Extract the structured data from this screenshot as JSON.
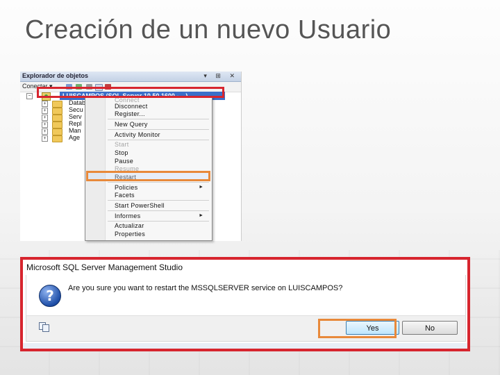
{
  "slide": {
    "title": "Creación de un nuevo Usuario"
  },
  "object_explorer": {
    "panel_title": "Explorador de objetos",
    "title_buttons": "▾ ⊞ ✕",
    "toolbar": {
      "connect_label": "Conectar ▾"
    },
    "root_node": "LUISCAMPOS (SQL Server 10.50.1600 - ...)",
    "tree_items": [
      "Datab",
      "Secu",
      "Serv",
      "Repl",
      "Man",
      "Age"
    ]
  },
  "context_menu": {
    "items": [
      {
        "label": "Connect",
        "disabled": true
      },
      {
        "label": "Disconnect",
        "disabled": false
      },
      {
        "label": "Register...",
        "disabled": false
      },
      {
        "label": "New Query",
        "disabled": false
      },
      {
        "label": "Activity Monitor",
        "disabled": false
      },
      {
        "label": "Start",
        "disabled": true
      },
      {
        "label": "Stop",
        "disabled": false
      },
      {
        "label": "Pause",
        "disabled": false
      },
      {
        "label": "Resume",
        "disabled": true
      },
      {
        "label": "Restart",
        "disabled": false
      },
      {
        "label": "Policies",
        "disabled": false,
        "submenu": true
      },
      {
        "label": "Facets",
        "disabled": false
      },
      {
        "label": "Start PowerShell",
        "disabled": false
      },
      {
        "label": "Informes",
        "disabled": false,
        "submenu": true
      },
      {
        "label": "Actualizar",
        "disabled": false
      },
      {
        "label": "Properties",
        "disabled": false
      }
    ],
    "submenu_arrow": "►"
  },
  "dialog": {
    "title": "Microsoft SQL Server Management Studio",
    "message": "Are you sure you want to restart the MSSQLSERVER service on LUISCAMPOS?",
    "help_glyph": "?",
    "yes_label": "Yes",
    "no_label": "No"
  },
  "colors": {
    "highlight_red": "#d7252e",
    "highlight_orange": "#e8893a",
    "selection_blue": "#3b6fc9"
  },
  "icons": [
    "server-icon",
    "folder-icon",
    "help-icon",
    "copy-icon",
    "expand-icon",
    "submenu-arrow-icon"
  ]
}
